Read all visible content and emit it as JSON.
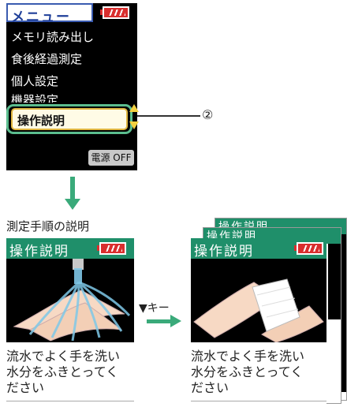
{
  "menu": {
    "title": "メニュー",
    "items": [
      "メモリ読み出し",
      "食後経過測定",
      "個人設定",
      "機器設定"
    ],
    "selected_item": "操作説明",
    "power_off": "電源 OFF"
  },
  "callout": {
    "marker": "②"
  },
  "caption": "測定手順の説明",
  "key_label": "▼キー",
  "screen_title": "操作説明",
  "screen_text_lines": [
    "流水でよく手を洗い",
    "水分をふきとってく",
    "ださい"
  ],
  "colors": {
    "header_green": "#1f8f6a",
    "arrow_green": "#3aaa7a",
    "battery_red": "#d92e2e",
    "highlight": "#5bbd8e"
  }
}
